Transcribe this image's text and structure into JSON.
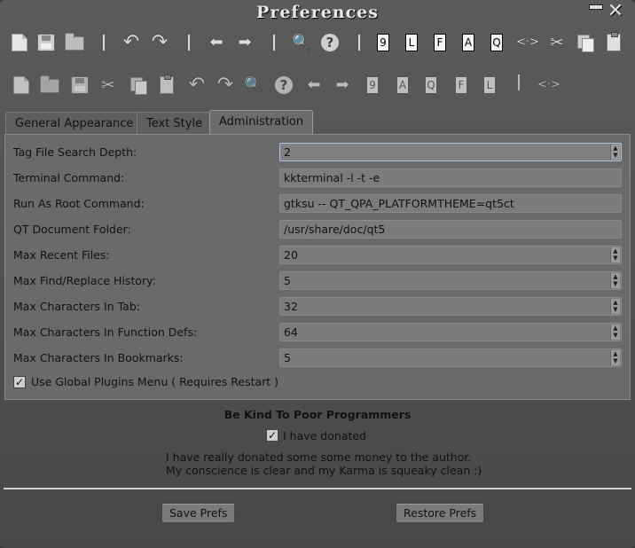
{
  "window": {
    "title": "Preferences"
  },
  "toolbar_main": {
    "icons": [
      "new-document-icon",
      "save-icon",
      "open-folder-icon",
      "undo-icon",
      "redo-icon",
      "back-arrow-icon",
      "forward-arrow-icon",
      "search-icon",
      "help-icon",
      "nine-box-icon",
      "l-box-icon",
      "f-box-icon",
      "a-box-icon",
      "q-box-icon",
      "code-tag-icon",
      "cut-icon",
      "copy-icon",
      "paste-icon"
    ],
    "box_labels": [
      "9",
      "L",
      "F",
      "A",
      "Q"
    ],
    "glyphs": {
      "undo": "↶",
      "redo": "↷",
      "back": "⬅",
      "forward": "➡",
      "search": "🔍",
      "help": "?",
      "tag": "<·>",
      "cut": "✂"
    }
  },
  "toolbar_preview": {
    "box_labels": [
      "9",
      "A",
      "Q",
      "F",
      "L"
    ]
  },
  "tabs": [
    {
      "label": "General Appearance"
    },
    {
      "label": "Text Style"
    },
    {
      "label": "Administration"
    }
  ],
  "settings": {
    "tag_depth": {
      "label": "Tag File Search Depth:",
      "value": "2"
    },
    "terminal": {
      "label": "Terminal Command:",
      "value": "kkterminal -l -t -e"
    },
    "root_cmd": {
      "label": "Run As Root Command:",
      "value": "gtksu -- QT_QPA_PLATFORMTHEME=qt5ct"
    },
    "qt_doc": {
      "label": "QT Document Folder:",
      "value": "/usr/share/doc/qt5"
    },
    "max_recent": {
      "label": "Max Recent Files:",
      "value": "20"
    },
    "max_find": {
      "label": "Max Find/Replace History:",
      "value": "5"
    },
    "max_tab": {
      "label": "Max Characters In Tab:",
      "value": "32"
    },
    "max_func": {
      "label": "Max Characters In Function Defs:",
      "value": "64"
    },
    "max_bookmarks": {
      "label": "Max Characters In Bookmarks:",
      "value": "5"
    },
    "global_plugins": {
      "label": "Use Global Plugins Menu ( Requires Restart )",
      "checked": true
    }
  },
  "donate": {
    "title": "Be Kind To Poor Programmers",
    "checkbox_label": "I have donated",
    "checked": true,
    "message_line1": "I have really donated some some money to the author.",
    "message_line2": "My conscience is clear and my Karma is squeaky clean :)"
  },
  "buttons": {
    "save": "Save Prefs",
    "restore": "Restore Prefs"
  },
  "check_mark": "✓",
  "colors": {
    "window_bg": "#474747",
    "panel_bg": "#6a6a6a",
    "field_bg": "#7c7c7c",
    "focus_border": "#a9c6e6"
  }
}
